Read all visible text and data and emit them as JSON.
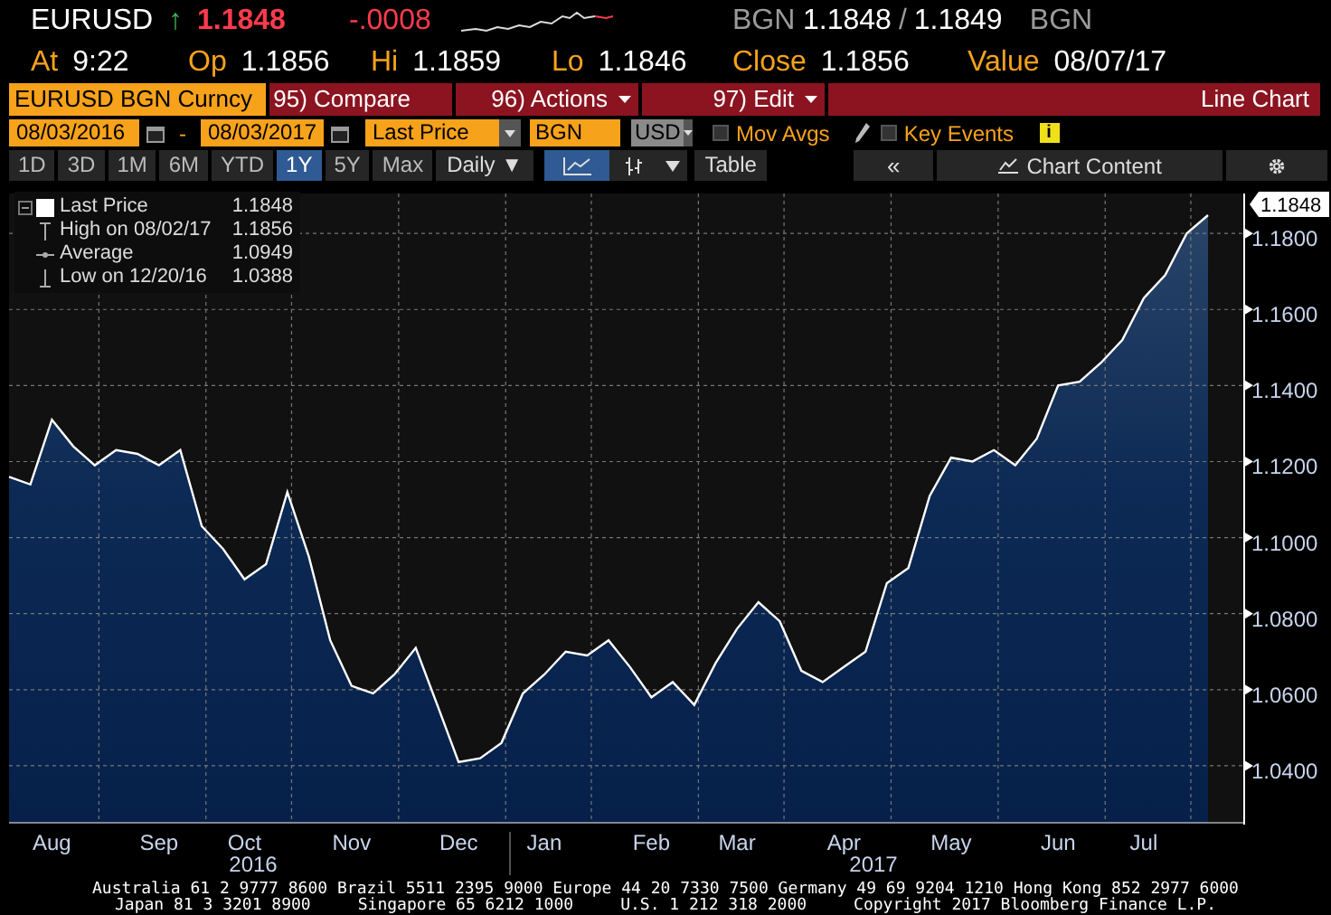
{
  "header": {
    "ticker": "EURUSD",
    "direction_arrow": "↑",
    "last": "1.1848",
    "change": "-.0008",
    "source_left": "BGN",
    "bid": "1.1848",
    "separator": "/",
    "ask": "1.1849",
    "source_right": "BGN"
  },
  "quote_fields": [
    {
      "label": "At",
      "value": "9:22"
    },
    {
      "label": "Op",
      "value": "1.1856"
    },
    {
      "label": "Hi",
      "value": "1.1859"
    },
    {
      "label": "Lo",
      "value": "1.1846"
    },
    {
      "label": "Close",
      "value": "1.1856"
    },
    {
      "label": "Value",
      "value": "08/07/17"
    }
  ],
  "toolbar": {
    "security": "EURUSD BGN Curncy",
    "menus": [
      {
        "label": "95) Compare",
        "dropdown": false
      },
      {
        "label": "96) Actions",
        "dropdown": true
      },
      {
        "label": "97) Edit",
        "dropdown": true
      }
    ],
    "title": "Line Chart"
  },
  "options": {
    "start_date": "08/03/2016",
    "date_separator": "-",
    "end_date": "08/03/2017",
    "field": "Last Price",
    "source": "BGN",
    "currency": "USD",
    "checkboxes": [
      {
        "label": "Mov Avgs",
        "checked": false
      },
      {
        "label": "Key Events",
        "checked": false
      }
    ],
    "info_badge": "i"
  },
  "periods": [
    {
      "label": "1D",
      "selected": false
    },
    {
      "label": "3D",
      "selected": false
    },
    {
      "label": "1M",
      "selected": false
    },
    {
      "label": "6M",
      "selected": false
    },
    {
      "label": "YTD",
      "selected": false
    },
    {
      "label": "1Y",
      "selected": true
    },
    {
      "label": "5Y",
      "selected": false
    },
    {
      "label": "Max",
      "selected": false
    }
  ],
  "frequency": "Daily ▼",
  "chart_tools": [
    {
      "kind": "line",
      "selected": true
    },
    {
      "kind": "bars",
      "selected": false
    },
    {
      "kind": "menu",
      "selected": false
    }
  ],
  "table_button": "Table",
  "collapse_button": "«",
  "chart_content_button": "Chart Content",
  "legend": [
    {
      "kind": "series",
      "value": "1.1848"
    },
    {
      "kind": "high",
      "label": "High on 08/02/17",
      "value": "1.1856"
    },
    {
      "kind": "average",
      "label": "Average",
      "value": "1.0949"
    },
    {
      "kind": "low",
      "label": "Low on 12/20/16",
      "value": "1.0388"
    }
  ],
  "chart": {
    "chart_data": {
      "type": "area",
      "categories": [
        null,
        null,
        "Aug",
        null,
        null,
        null,
        null,
        "Sep",
        null,
        null,
        null,
        "Oct",
        null,
        null,
        null,
        null,
        "Nov",
        null,
        null,
        null,
        null,
        "Dec",
        null,
        null,
        null,
        "Jan",
        null,
        null,
        null,
        null,
        "Feb",
        null,
        null,
        null,
        "Mar",
        null,
        null,
        null,
        null,
        "Apr",
        null,
        null,
        null,
        null,
        "May",
        null,
        null,
        null,
        null,
        "Jun",
        null,
        null,
        null,
        "Jul",
        null,
        null,
        null
      ],
      "series": [
        {
          "name": "Last Price",
          "color": "#ffffff",
          "values": [
            1.116,
            1.114,
            1.131,
            1.124,
            1.119,
            1.123,
            1.122,
            1.119,
            1.123,
            1.103,
            1.097,
            1.089,
            1.093,
            1.112,
            1.095,
            1.073,
            1.061,
            1.059,
            1.064,
            1.071,
            1.056,
            1.041,
            1.042,
            1.046,
            1.059,
            1.064,
            1.07,
            1.069,
            1.073,
            1.066,
            1.058,
            1.062,
            1.056,
            1.067,
            1.076,
            1.083,
            1.078,
            1.065,
            1.062,
            1.066,
            1.07,
            1.088,
            1.092,
            1.111,
            1.121,
            1.12,
            1.123,
            1.119,
            1.126,
            1.14,
            1.141,
            1.146,
            1.152,
            1.163,
            1.169,
            1.18,
            1.1848
          ]
        }
      ],
      "ylim": [
        1.025,
        1.1905
      ],
      "yticks": [
        {
          "value": 1.04,
          "label": "1.0400"
        },
        {
          "value": 1.06,
          "label": "1.0600"
        },
        {
          "value": 1.08,
          "label": "1.0800"
        },
        {
          "value": 1.1,
          "label": "1.1000"
        },
        {
          "value": 1.12,
          "label": "1.1200"
        },
        {
          "value": 1.14,
          "label": "1.1400"
        },
        {
          "value": 1.16,
          "label": "1.1600"
        },
        {
          "value": 1.18,
          "label": "1.1800"
        }
      ],
      "grid": true,
      "annotations": [
        "1.1848"
      ]
    },
    "year_labels": [
      "2016",
      "2017"
    ]
  },
  "footer": {
    "line_1": "Australia 61 2 9777 8600 Brazil 5511 2395 9000 Europe 44 20 7330 7500 Germany 49 69 9204 1210 Hong Kong 852 2977 6000",
    "line_2": [
      "Japan 81 3 3201 8900",
      "Singapore 65 6212 1000",
      "U.S. 1 212 318 2000",
      "Copyright 2017 Bloomberg Finance L.P."
    ]
  }
}
